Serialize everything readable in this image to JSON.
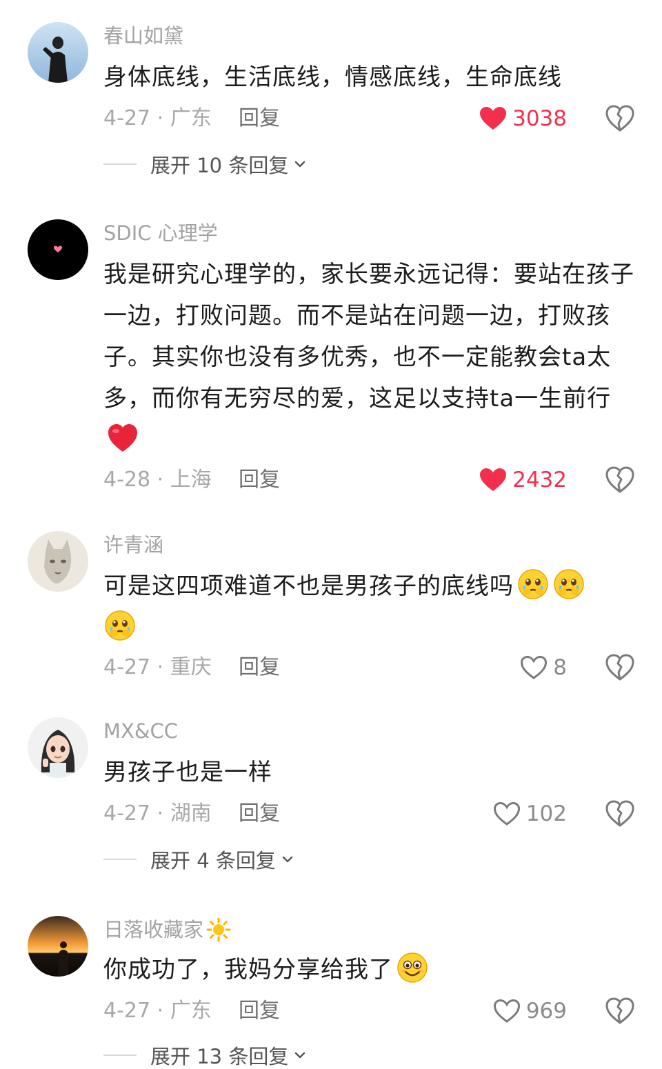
{
  "comments": [
    {
      "username": "春山如黛",
      "text": "身体底线，生活底线，情感底线，生命底线",
      "date_location": "4-27 · 广东",
      "reply_label": "回复",
      "likes": "3038",
      "liked": true,
      "expand_label": "展开 10 条回复"
    },
    {
      "username": "SDIC 心理学",
      "text": "我是研究心理学的，家长要永远记得：要站在孩子一边，打败问题。而不是站在问题一边，打败孩子。其实你也没有多优秀，也不一定能教会ta太多，而你有无穷尽的爱，这足以支持ta一生前行",
      "date_location": "4-28 · 上海",
      "reply_label": "回复",
      "likes": "2432",
      "liked": true
    },
    {
      "username": "许青涵",
      "text": "可是这四项难道不也是男孩子的底线吗",
      "date_location": "4-27 · 重庆",
      "reply_label": "回复",
      "likes": "8",
      "liked": false
    },
    {
      "username": "MX&CC",
      "text": "男孩子也是一样",
      "date_location": "4-27 · 湖南",
      "reply_label": "回复",
      "likes": "102",
      "liked": false,
      "expand_label": "展开 4 条回复"
    },
    {
      "username": "日落收藏家",
      "text": "你成功了，我妈分享给我了",
      "date_location": "4-27 · 广东",
      "reply_label": "回复",
      "likes": "969",
      "liked": false,
      "expand_label": "展开 13 条回复"
    }
  ],
  "icons": {
    "like": "heart-icon",
    "dislike": "broken-heart-icon",
    "expand": "chevron-down-icon",
    "heart_emoji": "red-heart-emoji",
    "cry_emoji": "crying-face-emoji",
    "smile_emoji": "smiling-face-emoji",
    "sun_emoji": "sun-emoji"
  },
  "colors": {
    "liked": "#f2304d",
    "muted": "#a8a8a8"
  }
}
